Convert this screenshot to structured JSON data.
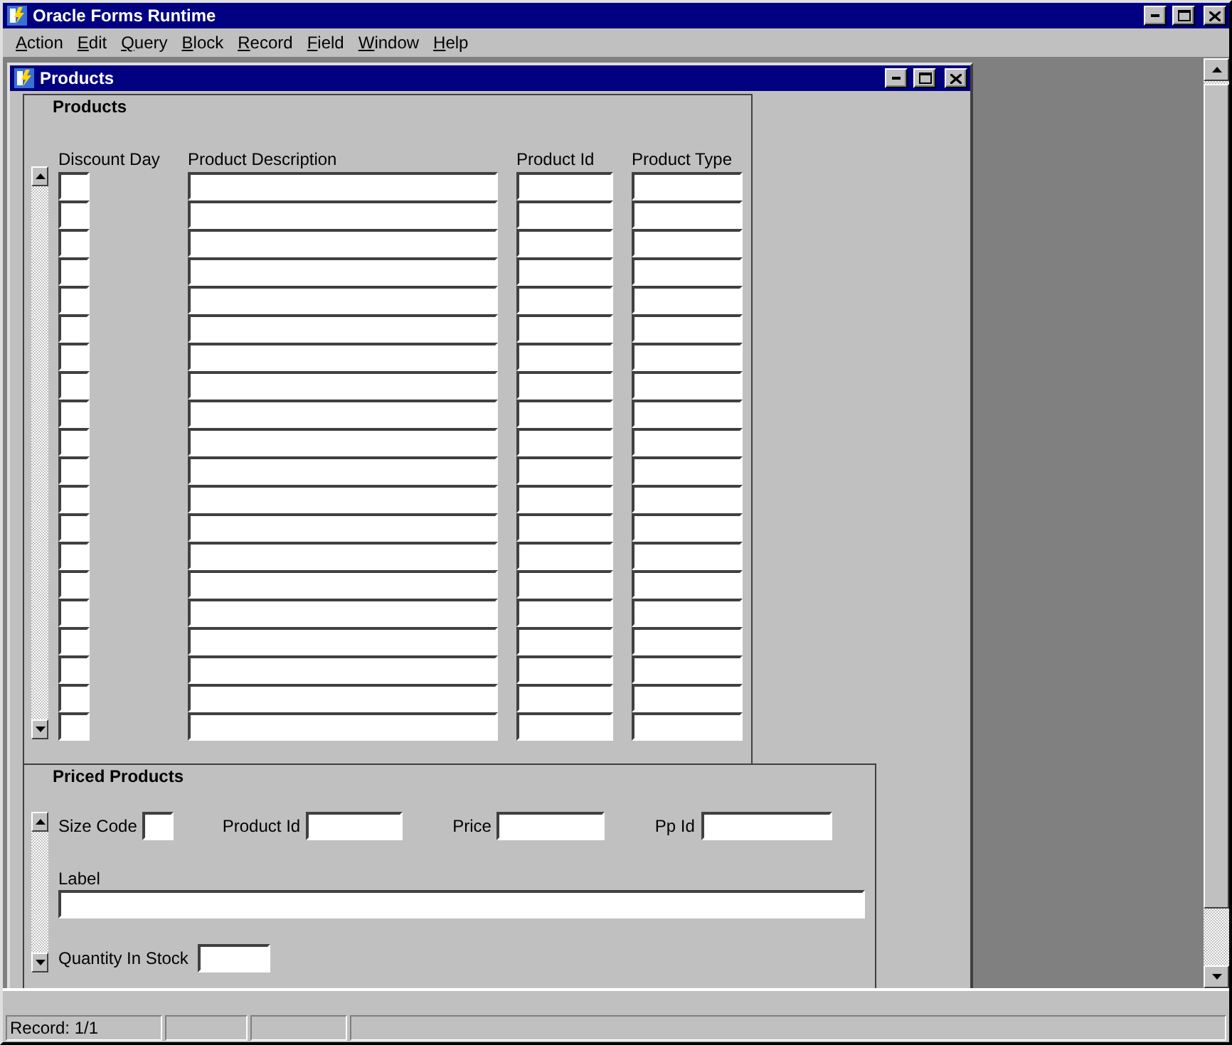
{
  "window": {
    "title": "Oracle Forms Runtime"
  },
  "menu": [
    "Action",
    "Edit",
    "Query",
    "Block",
    "Record",
    "Field",
    "Window",
    "Help"
  ],
  "form_window": {
    "title": "Products"
  },
  "products_block": {
    "title": "Products",
    "columns": [
      "Discount Day",
      "Product Description",
      "Product Id",
      "Product Type"
    ]
  },
  "priced_block": {
    "title": "Priced Products",
    "size_code_label": "Size Code",
    "product_id_label": "Product Id",
    "price_label": "Price",
    "pp_id_label": "Pp Id",
    "label_label": "Label",
    "quantity_label": "Quantity In Stock"
  },
  "status_bar": [
    "Record: 1/1"
  ]
}
